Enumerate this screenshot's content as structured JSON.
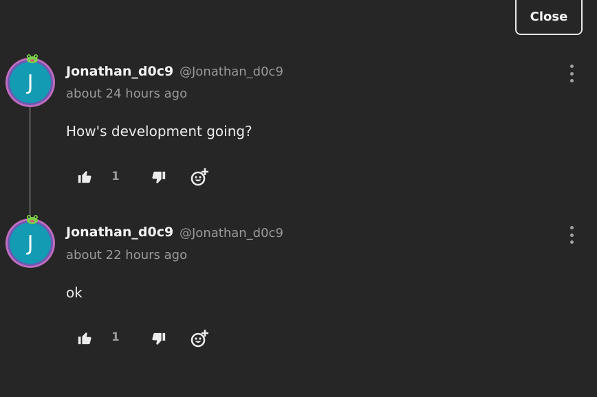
{
  "header": {
    "close_label": "Close"
  },
  "comments": [
    {
      "avatar_letter": "J",
      "username": "Jonathan_d0c9",
      "handle": "@Jonathan_d0c9",
      "timestamp": "about 24 hours ago",
      "body": "How's development going?",
      "like_count": "1"
    },
    {
      "avatar_letter": "J",
      "username": "Jonathan_d0c9",
      "handle": "@Jonathan_d0c9",
      "timestamp": "about 22 hours ago",
      "body": "ok",
      "like_count": "1"
    }
  ],
  "icons": {
    "like": "thumbs-up-icon",
    "dislike": "thumbs-down-icon",
    "react": "add-reaction-icon",
    "menu": "more-vertical-icon",
    "avatar_badge": "frog-icon"
  },
  "colors": {
    "background": "#262626",
    "avatar_fill": "#129bb3",
    "avatar_ring": "#c06cc0"
  }
}
